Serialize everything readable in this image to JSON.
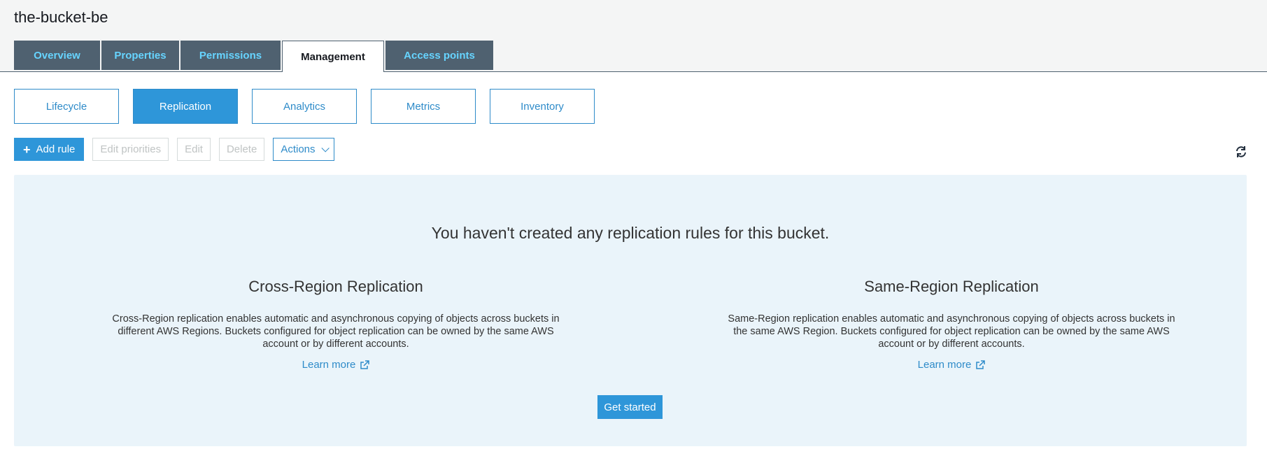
{
  "bucket": {
    "title": "the-bucket-be"
  },
  "tabs": [
    {
      "label": "Overview"
    },
    {
      "label": "Properties"
    },
    {
      "label": "Permissions"
    },
    {
      "label": "Management"
    },
    {
      "label": "Access points"
    }
  ],
  "subtabs": [
    {
      "label": "Lifecycle"
    },
    {
      "label": "Replication"
    },
    {
      "label": "Analytics"
    },
    {
      "label": "Metrics"
    },
    {
      "label": "Inventory"
    }
  ],
  "toolbar": {
    "add_rule": "Add rule",
    "edit_priorities": "Edit priorities",
    "edit": "Edit",
    "delete": "Delete",
    "actions": "Actions"
  },
  "panel": {
    "message": "You haven't created any replication rules for this bucket.",
    "cross": {
      "title": "Cross-Region Replication",
      "description": "Cross-Region replication enables automatic and asynchronous copying of objects across buckets in different AWS Regions. Buckets configured for object replication can be owned by the same AWS account or by different accounts.",
      "learn_more": "Learn more"
    },
    "same": {
      "title": "Same-Region Replication",
      "description": "Same-Region replication enables automatic and asynchronous copying of objects across buckets in the same AWS Region. Buckets configured for object replication can be owned by the same AWS account or by different accounts.",
      "learn_more": "Learn more"
    },
    "get_started": "Get started"
  },
  "icons": {
    "refresh": "refresh-icon",
    "external_link": "external-link-icon",
    "plus": "plus-icon",
    "chevron": "chevron-down-icon"
  },
  "colors": {
    "accent": "#2e96d9",
    "tab_bg": "#4f6170",
    "tab_text": "#66d4ff",
    "panel_bg": "#eaf4fa"
  }
}
